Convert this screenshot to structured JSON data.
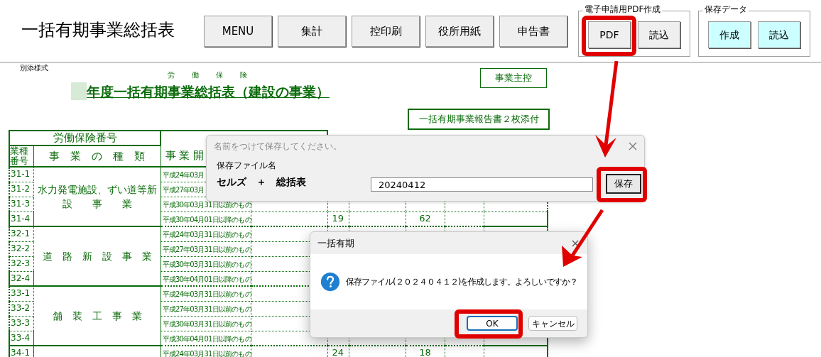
{
  "toolbar": {
    "title": "一括有期事業総括表",
    "buttons": [
      "MENU",
      "集計",
      "控印刷",
      "役所用紙",
      "申告書"
    ],
    "groups": [
      {
        "label": "電子申請用PDF作成",
        "buttons": [
          {
            "label": "PDF",
            "kind": "plain"
          },
          {
            "label": "読込",
            "kind": "plain"
          }
        ]
      },
      {
        "label": "保存データ",
        "buttons": [
          {
            "label": "作成",
            "kind": "cyan"
          },
          {
            "label": "読込",
            "kind": "cyan"
          }
        ]
      }
    ]
  },
  "sheet": {
    "form_note": "別添様式",
    "title_ruby": [
      "労",
      "働",
      "保",
      "険"
    ],
    "title": "年度一括有期事業総括表（建設の事業）",
    "stamp": "事業主控",
    "attachment_note": "一括有期事業報告書２枚添付",
    "table": {
      "insurance_number_label": "労働保険番号",
      "header_code": [
        "業種",
        "番号"
      ],
      "header_type": "事　業　の　種　類",
      "header_start": "事 業 開",
      "groups": [
        {
          "type_lines": [
            "水力発電施設、ずい道等新",
            "設　　事　　業"
          ],
          "rows": [
            {
              "code": "31-1",
              "period": "平成24年03月"
            },
            {
              "code": "31-2",
              "period": "平成27年03月"
            },
            {
              "code": "31-3",
              "period": "平成30年03月31日以前のもの"
            },
            {
              "code": "31-4",
              "period": "平成30年04月01日以降のもの",
              "column_5": "19",
              "column_7": "62"
            }
          ]
        },
        {
          "type_lines": [
            "道　路　新　設　事　業"
          ],
          "rows": [
            {
              "code": "32-1",
              "period": "平成24年03月31日以前のもの"
            },
            {
              "code": "32-2",
              "period": "平成27年03月31日以前のもの"
            },
            {
              "code": "32-3",
              "period": "平成30年03月31日以前のもの"
            },
            {
              "code": "32-4",
              "period": "平成30年04月01日以降のもの"
            }
          ]
        },
        {
          "type_lines": [
            "舗　装　工　事　業"
          ],
          "rows": [
            {
              "code": "33-1",
              "period": "平成24年03月31日以前のもの"
            },
            {
              "code": "33-2",
              "period": "平成27年03月31日以前のもの"
            },
            {
              "code": "33-3",
              "period": "平成30年03月31日以前のもの"
            },
            {
              "code": "33-4",
              "period": "平成30年04月01日以降のもの"
            }
          ]
        },
        {
          "rows": [
            {
              "code": "34-1",
              "period": "平成24年03月31日以前のもの",
              "column_5": "24",
              "column_7": "18"
            }
          ]
        }
      ]
    }
  },
  "save_dialog": {
    "title": "名前をつけて保存してください。",
    "label": "保存ファイル名",
    "name_parts": "セルズ　＋　総括表",
    "value": "20240412",
    "button": "保存"
  },
  "confirm_dialog": {
    "title": "一括有期",
    "message": "保存ファイル(２０２４０４１２)を作成します。よろしいですか？",
    "buttons": [
      {
        "label": "OK",
        "selected": true
      },
      {
        "label": "キャンセル",
        "selected": false
      }
    ]
  }
}
